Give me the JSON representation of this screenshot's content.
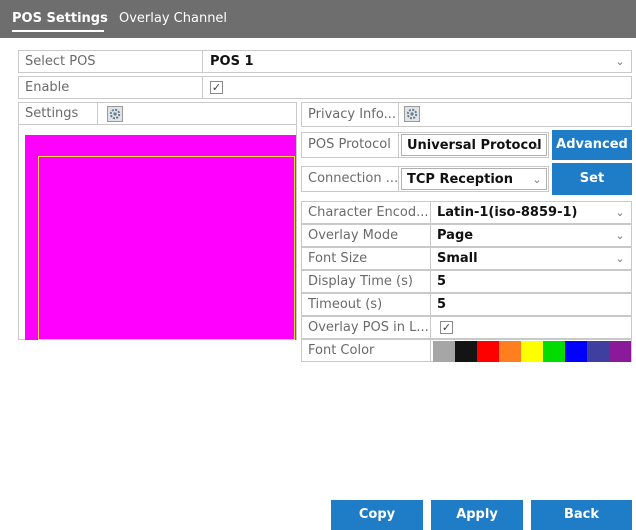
{
  "tabs": {
    "pos_settings": "POS Settings",
    "overlay_channel": "Overlay Channel"
  },
  "select_pos": {
    "label": "Select POS",
    "value": "POS 1"
  },
  "enable": {
    "label": "Enable",
    "checked": true,
    "check_mark": "✓"
  },
  "settings": {
    "label": "Settings"
  },
  "privacy_info": {
    "label": "Privacy Info..."
  },
  "pos_protocol": {
    "label": "POS Protocol",
    "value": "Universal Protocol"
  },
  "connection": {
    "label": "Connection ...",
    "value": "TCP Reception"
  },
  "character_encoding": {
    "label": "Character Encod...",
    "value": "Latin-1(iso-8859-1)"
  },
  "overlay_mode": {
    "label": "Overlay Mode",
    "value": "Page"
  },
  "font_size": {
    "label": "Font Size",
    "value": "Small"
  },
  "display_time": {
    "label": "Display Time (s)",
    "value": "5"
  },
  "timeout": {
    "label": "Timeout (s)",
    "value": "5"
  },
  "overlay_pos_live": {
    "label": "Overlay POS in L...",
    "checked": true,
    "check_mark": "✓"
  },
  "font_color": {
    "label": "Font Color"
  },
  "chevron_glyph": "⌄",
  "buttons": {
    "advanced": "Advanced",
    "set": "Set",
    "copy": "Copy",
    "apply": "Apply",
    "back": "Back"
  },
  "colors": {
    "tab_bar": "#6e6e6e",
    "button_blue": "#1f7cc7",
    "preview_magenta": "#ff00ff",
    "overlay_frame": "#ffd84a",
    "swatches": [
      "#a6a6a6",
      "#141414",
      "#ff0000",
      "#ff7f1e",
      "#ffff00",
      "#00dc00",
      "#0000ff",
      "#3f3f9f",
      "#8b1a9b"
    ]
  },
  "icons": {
    "settings": "gear-icon",
    "privacy": "gear-icon",
    "dropdown": "chevron-down-icon"
  }
}
